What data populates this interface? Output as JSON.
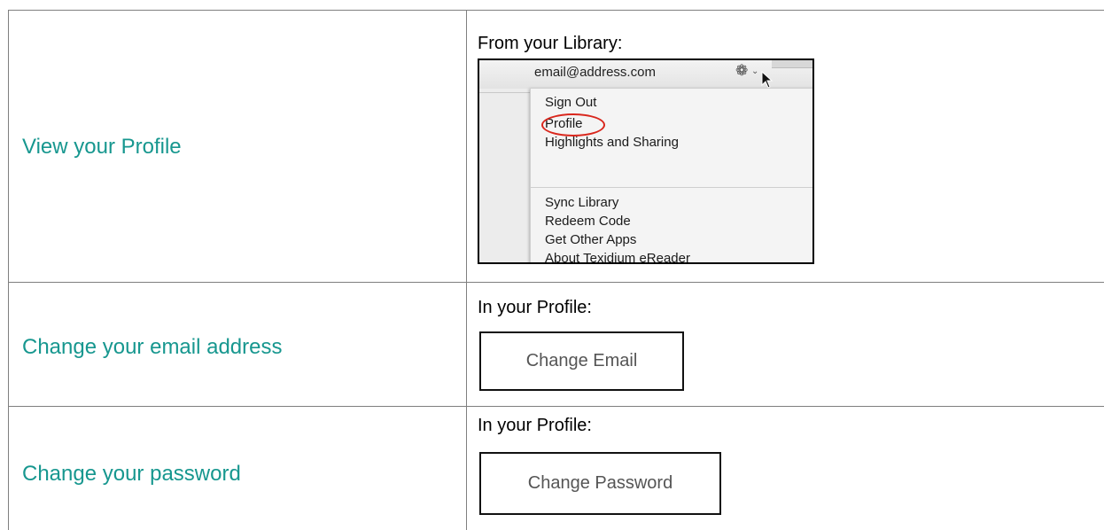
{
  "rows": [
    {
      "task": "View your Profile",
      "caption": "From your Library:",
      "screenshot": {
        "email": "email@address.com",
        "gear_icon": "gear-icon",
        "chevron_icon": "chevron-down-icon",
        "cursor_icon": "mouse-pointer-icon",
        "menu_group_1": [
          "Sign Out",
          "Profile",
          "Highlights and Sharing"
        ],
        "menu_group_2": [
          "Sync Library",
          "Redeem Code",
          "Get Other Apps",
          "About Texidium eReader"
        ],
        "highlighted_item": "Profile",
        "highlight_color": "#d9261c"
      }
    },
    {
      "task": "Change your email address",
      "caption": "In your Profile:",
      "button_label": "Change Email"
    },
    {
      "task": "Change your password",
      "caption": "In your Profile:",
      "button_label": "Change Password"
    }
  ],
  "colors": {
    "task_text": "#17978f",
    "table_border": "#7f7f7f"
  }
}
